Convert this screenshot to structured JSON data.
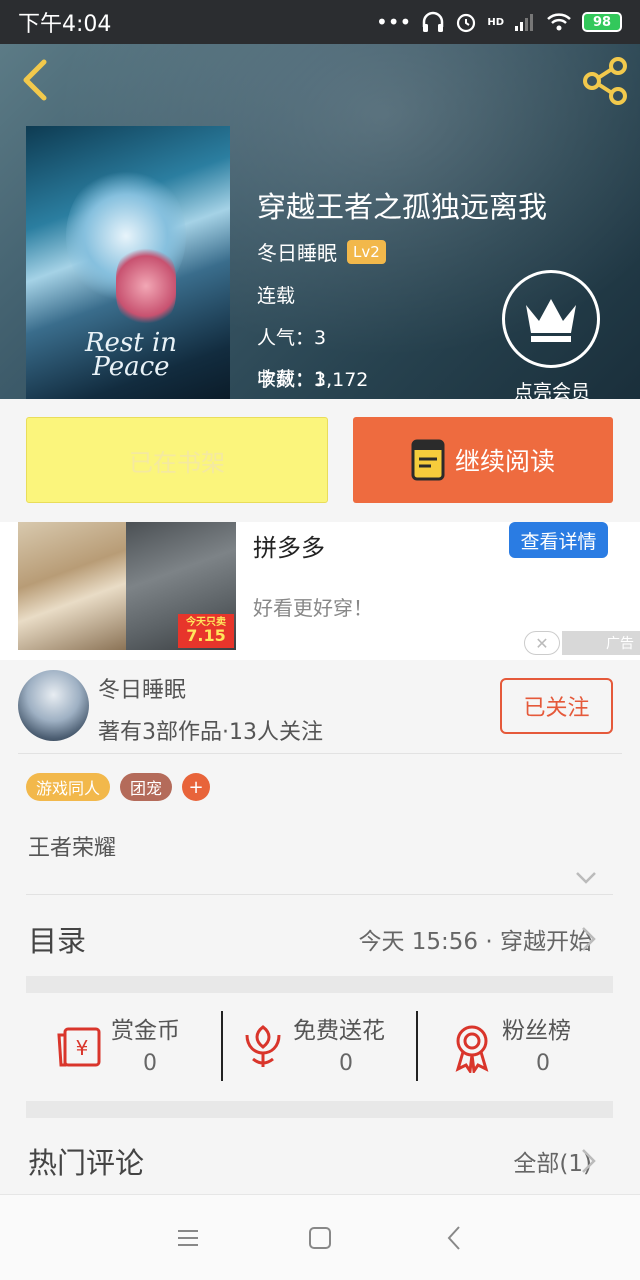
{
  "status_bar": {
    "time": "下午4:04",
    "network": "HD",
    "battery": "98"
  },
  "book": {
    "title": "穿越王者之孤独远离我",
    "author": "冬日睡眠",
    "author_level": "Lv2",
    "status": "连载",
    "popularity": "人气：3",
    "word_count": "字数：3,172",
    "favorites": "收藏：1",
    "cover_text": "Rest in Peace",
    "vip_label": "点亮会员"
  },
  "actions": {
    "shelf_label": "已在书架",
    "read_label": "继续阅读"
  },
  "ad": {
    "title": "拼多多",
    "desc": "好看更好穿！",
    "button": "查看详情",
    "price_caption": "今天只卖",
    "price": "7.15",
    "tag": "广告"
  },
  "author_card": {
    "name": "冬日睡眠",
    "stats": "著有3部作品·13人关注",
    "follow_label": "已关注"
  },
  "tags": [
    {
      "label": "游戏同人",
      "color": "#f2b84b"
    },
    {
      "label": "团宠",
      "color": "#b46b5a"
    }
  ],
  "tag_add": "+",
  "description": "王者荣耀",
  "toc": {
    "title": "目录",
    "latest": "今天 15:56 · 穿越开始"
  },
  "rewards": [
    {
      "label": "赏金币",
      "value": "0",
      "icon": "red-envelope-icon"
    },
    {
      "label": "免费送花",
      "value": "0",
      "icon": "flower-icon"
    },
    {
      "label": "粉丝榜",
      "value": "0",
      "icon": "medal-icon"
    }
  ],
  "comments": {
    "title": "热门评论",
    "all_label": "全部(1)"
  },
  "colors": {
    "accent": "#ee6b3f",
    "follow": "#e5593a",
    "shelf": "#fbf57c",
    "icon_red": "#d9352b"
  }
}
